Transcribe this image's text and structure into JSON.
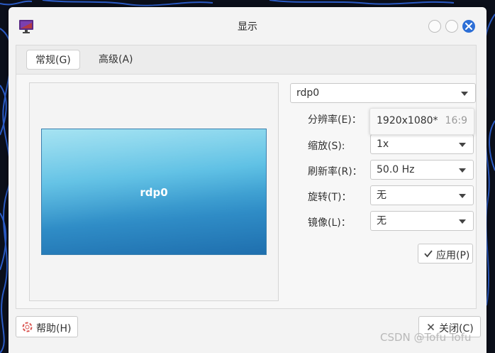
{
  "window": {
    "title": "显示"
  },
  "tabs": [
    {
      "label": "常规(G)",
      "active": true
    },
    {
      "label": "高级(A)",
      "active": false
    }
  ],
  "preview": {
    "monitor_label": "rdp0"
  },
  "monitor_select": {
    "value": "rdp0"
  },
  "form": {
    "resolution": {
      "label": "分辨率(E)：",
      "value": "1920x1080*",
      "ratio": "16:9"
    },
    "scale": {
      "label": "缩放(S):",
      "value": "1x"
    },
    "refresh": {
      "label": "刷新率(R)：",
      "value": "50.0 Hz"
    },
    "rotation": {
      "label": "旋转(T)：",
      "value": "无"
    },
    "mirror": {
      "label": "镜像(L)：",
      "value": "无"
    }
  },
  "buttons": {
    "apply": "应用(P)",
    "help": "帮助(H)",
    "close": "关闭(C)"
  },
  "watermark": "CSDN @Tofu Tofu",
  "colors": {
    "accent": "#2d6fd6",
    "desktop": "#0b0f1a",
    "desktop_lines": "#2f64d8"
  },
  "icons": [
    "monitor-icon",
    "close-icon",
    "check-icon",
    "help-icon",
    "x-icon",
    "chevron-down-icon"
  ]
}
